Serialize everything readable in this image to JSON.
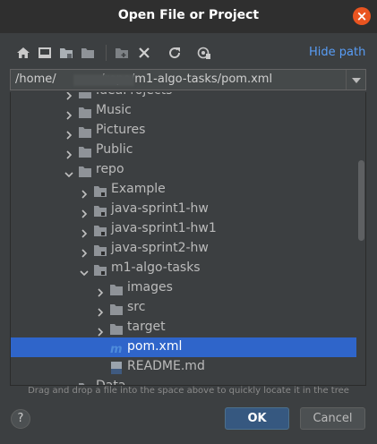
{
  "window": {
    "title": "Open File or Project",
    "close_glyph": "×"
  },
  "toolbar": {
    "icons": [
      "home-icon",
      "desktop-icon",
      "project-folder-icon",
      "module-folder-icon",
      "new-folder-icon",
      "delete-icon",
      "refresh-icon",
      "show-hidden-icon"
    ],
    "hide_path_label": "Hide path"
  },
  "path": {
    "value": "/home/            /repo/m1-algo-tasks/pom.xml"
  },
  "tree": {
    "items": [
      {
        "label": "IdeaProjects",
        "depth": 1,
        "type": "folder",
        "expanded": false
      },
      {
        "label": "Music",
        "depth": 1,
        "type": "folder",
        "expanded": false
      },
      {
        "label": "Pictures",
        "depth": 1,
        "type": "folder",
        "expanded": false
      },
      {
        "label": "Public",
        "depth": 1,
        "type": "folder",
        "expanded": false
      },
      {
        "label": "repo",
        "depth": 1,
        "type": "folder",
        "expanded": true
      },
      {
        "label": "Example",
        "depth": 2,
        "type": "module",
        "expanded": false
      },
      {
        "label": "java-sprint1-hw",
        "depth": 2,
        "type": "module",
        "expanded": false
      },
      {
        "label": "java-sprint1-hw1",
        "depth": 2,
        "type": "module",
        "expanded": false
      },
      {
        "label": "java-sprint2-hw",
        "depth": 2,
        "type": "module",
        "expanded": false
      },
      {
        "label": "m1-algo-tasks",
        "depth": 2,
        "type": "module",
        "expanded": true
      },
      {
        "label": "images",
        "depth": 3,
        "type": "folder",
        "expanded": false
      },
      {
        "label": "src",
        "depth": 3,
        "type": "folder",
        "expanded": false
      },
      {
        "label": "target",
        "depth": 3,
        "type": "folder",
        "expanded": false
      },
      {
        "label": "pom.xml",
        "depth": 3,
        "type": "maven-file",
        "selected": true
      },
      {
        "label": "README.md",
        "depth": 3,
        "type": "markdown-file"
      },
      {
        "label": "Data...",
        "depth": 1,
        "type": "folder",
        "expanded": false
      }
    ]
  },
  "hint_text": "Drag and drop a file into the space above to quickly locate it in the tree",
  "buttons": {
    "help": "?",
    "ok": "OK",
    "cancel": "Cancel"
  },
  "colors": {
    "selection": "#2f65ca",
    "link": "#589df6",
    "close": "#e95420",
    "folder": "#8f9398",
    "maven": "#4e8cdb"
  }
}
